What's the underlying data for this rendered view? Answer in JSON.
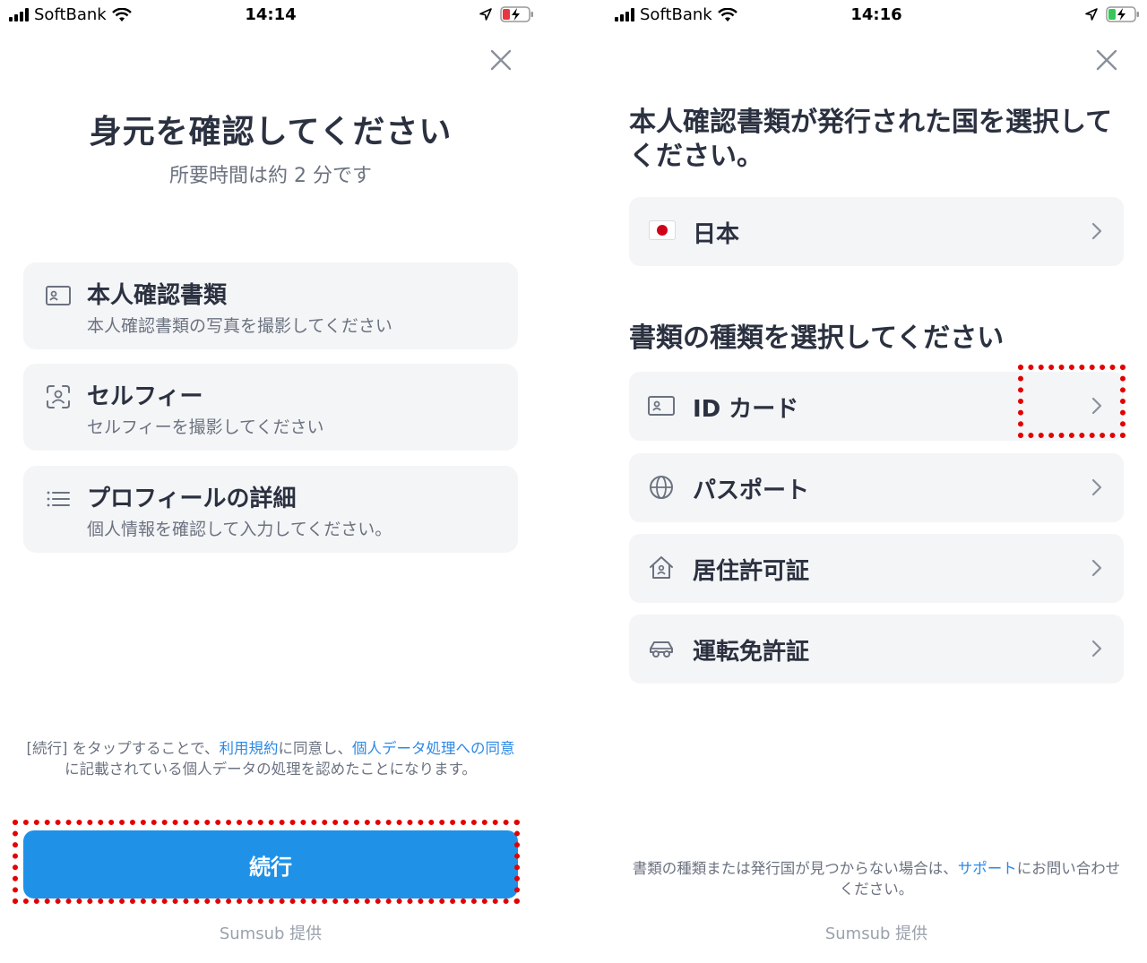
{
  "left": {
    "status": {
      "carrier": "SoftBank",
      "time": "14:14"
    },
    "title": "身元を確認してください",
    "subtitle": "所要時間は約 2 分です",
    "steps": [
      {
        "title": "本人確認書類",
        "desc": "本人確認書類の写真を撮影してください",
        "icon": "id-card-icon"
      },
      {
        "title": "セルフィー",
        "desc": "セルフィーを撮影してください",
        "icon": "face-scan-icon"
      },
      {
        "title": "プロフィールの詳細",
        "desc": "個人情報を確認して入力してください。",
        "icon": "list-icon"
      }
    ],
    "consent": {
      "part1": "[続行] をタップすることで、",
      "terms_link": "利用規約",
      "part2": "に同意し、",
      "privacy_link": "個人データ処理への同意",
      "part3": "に記載されている個人データの処理を認めたことになります。"
    },
    "continue_label": "続行",
    "powered_by": "Sumsub 提供"
  },
  "right": {
    "status": {
      "carrier": "SoftBank",
      "time": "14:16"
    },
    "country_title": "本人確認書類が発行された国を選択してください。",
    "country": {
      "label": "日本",
      "icon": "japan-flag-icon"
    },
    "doc_title": "書類の種類を選択してください",
    "doc_types": [
      {
        "label": "ID カード",
        "icon": "id-card-icon"
      },
      {
        "label": "パスポート",
        "icon": "globe-icon"
      },
      {
        "label": "居住許可証",
        "icon": "house-icon"
      },
      {
        "label": "運転免許証",
        "icon": "car-icon"
      }
    ],
    "help": {
      "part1": "書類の種類または発行国が見つからない場合は、",
      "support_link": "サポート",
      "part2": "にお問い合わせください。"
    },
    "powered_by": "Sumsub 提供"
  },
  "colors": {
    "accent": "#1f92e8",
    "link": "#2d8ae6",
    "highlight": "#e30000",
    "card": "#f4f5f7"
  }
}
